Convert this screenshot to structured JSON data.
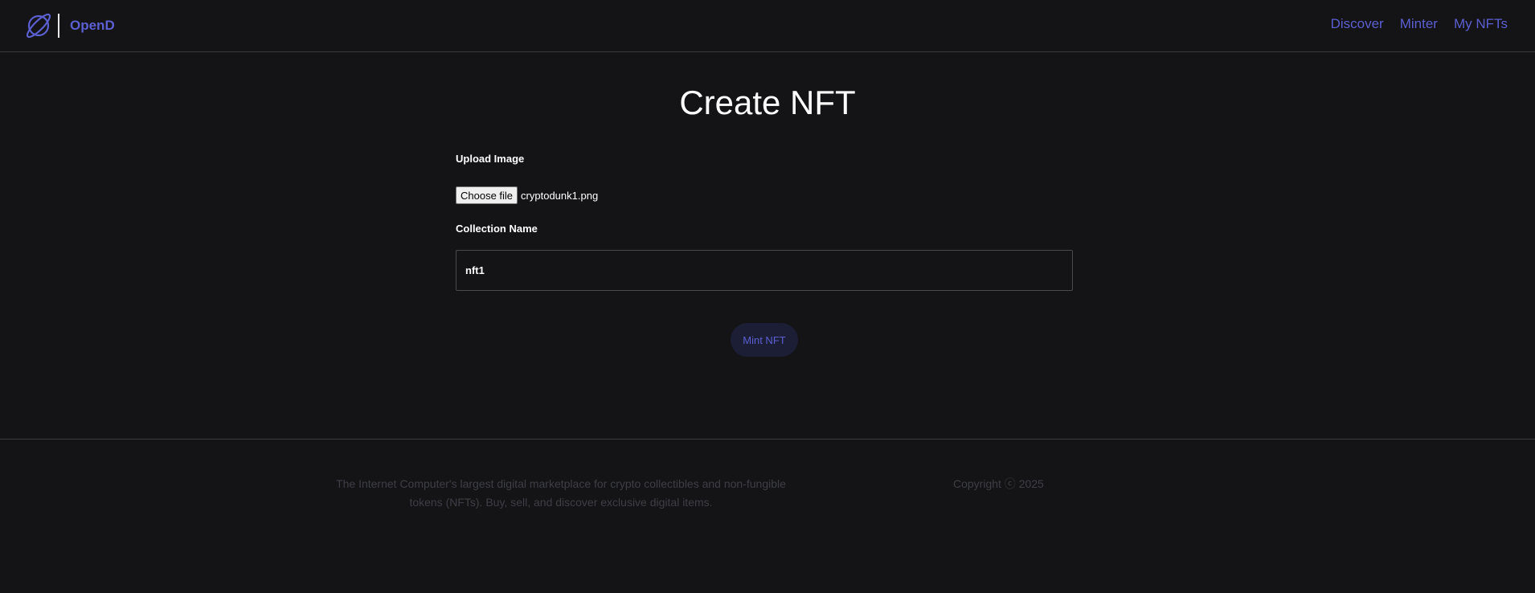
{
  "header": {
    "brand": "OpenD",
    "logo_icon": "planet-icon",
    "nav": {
      "discover": "Discover",
      "minter": "Minter",
      "my_nfts": "My NFTs"
    }
  },
  "main": {
    "title": "Create NFT",
    "upload": {
      "label": "Upload Image",
      "button_label": "Choose file",
      "file_name": "cryptodunk1.png"
    },
    "collection": {
      "label": "Collection Name",
      "value": "nft1"
    },
    "mint_button": "Mint NFT"
  },
  "footer": {
    "description": "The Internet Computer's largest digital marketplace for crypto collectibles and non-fungible tokens (NFTs). Buy, sell, and discover exclusive digital items.",
    "copyright": "Copyright ⓒ 2025"
  },
  "colors": {
    "background": "#141416",
    "accent": "#5b5fd0",
    "muted_text": "#3e3e47",
    "mint_button_bg": "#1c1e36",
    "border": "#3a3a3f"
  }
}
